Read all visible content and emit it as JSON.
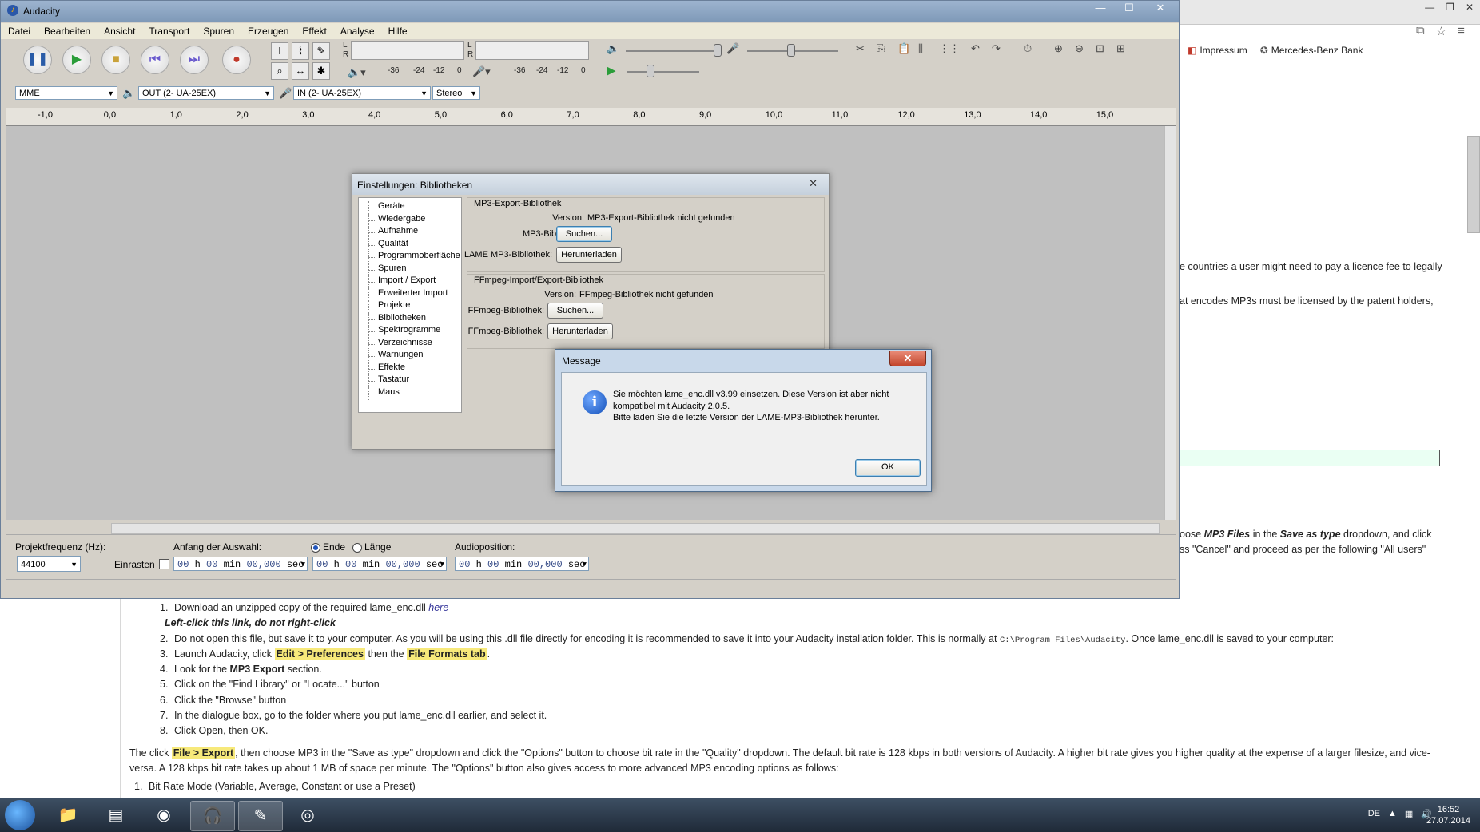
{
  "browser": {
    "bookmarks": [
      {
        "label": "Impressum",
        "icon": "impressum-icon"
      },
      {
        "label": "Mercedes-Benz Bank",
        "icon": "mercedes-icon"
      }
    ],
    "snippets": {
      "s1": "e countries a user might need to pay a licence fee to legally",
      "s2": "at encodes MP3s must be licensed by the patent holders,",
      "s3a": "oose ",
      "s3b": "MP3 Files",
      "s3c": " in the ",
      "s3d": "Save as type",
      "s3e": " dropdown, and click",
      "s4": "ss \"Cancel\" and proceed as per the following \"All users\""
    },
    "steps": [
      {
        "n": "1.",
        "text": "Download an unzipped copy of the required lame_enc.dll ",
        "link": "here"
      },
      {
        "n": "",
        "text": "Left-click this link, do not right-click"
      },
      {
        "n": "2.",
        "text": "Do not open this file, but save it to your computer. As you will be using this .dll file directly for encoding it is recommended to save it into your Audacity installation folder. This is normally at ",
        "mono": "C:\\Program Files\\Audacity",
        "after": ". Once lame_enc.dll is saved to your computer:"
      },
      {
        "n": "3.",
        "pre": "Launch Audacity, click ",
        "hl1": "Edit > Preferences",
        "mid": " then the ",
        "hl2": "File Formats tab",
        "post": "."
      },
      {
        "n": "4.",
        "pre": "Look for the ",
        "bold": "MP3 Export",
        "post": " section."
      },
      {
        "n": "5.",
        "text": "Click on the \"Find Library\" or \"Locate...\" button"
      },
      {
        "n": "6.",
        "text": "Click the \"Browse\" button"
      },
      {
        "n": "7.",
        "text": "In the dialogue box, go to the folder where you put lame_enc.dll earlier, and select it."
      },
      {
        "n": "8.",
        "text": "Click Open, then OK."
      }
    ],
    "para1_pre": "The click ",
    "para1_hl": "File > Export",
    "para1_post": ", then choose MP3 in the \"Save as type\" dropdown and click the \"Options\" button to choose bit rate in the \"Quality\" dropdown. The default bit rate is 128 kbps in both versions of Audacity. A higher bit rate gives you higher quality at the expense of a larger filesize, and vice-",
    "para2": "versa. A 128 kbps bit rate takes up about 1 MB of space per minute. The \"Options\" button also gives access to more advanced MP3 encoding options as follows:",
    "step_b1": "Bit Rate Mode (Variable, Average, Constant or use a Preset)"
  },
  "audacity": {
    "title": "Audacity",
    "menu": [
      "Datei",
      "Bearbeiten",
      "Ansicht",
      "Transport",
      "Spuren",
      "Erzeugen",
      "Effekt",
      "Analyse",
      "Hilfe"
    ],
    "meter_ticks": [
      "-36",
      "-24",
      "-12",
      "0"
    ],
    "meter_lr": [
      "L",
      "R"
    ],
    "devices": {
      "host": "MME",
      "output": "OUT (2- UA-25EX)",
      "input": "IN (2- UA-25EX)",
      "channels": "Stereo"
    },
    "ruler": [
      "-1,0",
      "0,0",
      "1,0",
      "2,0",
      "3,0",
      "4,0",
      "5,0",
      "6,0",
      "7,0",
      "8,0",
      "9,0",
      "10,0",
      "11,0",
      "12,0",
      "13,0",
      "14,0",
      "15,0"
    ],
    "selection": {
      "rate_label": "Projektfrequenz (Hz):",
      "rate": "44100",
      "snap_label": "Einrasten",
      "start_label": "Anfang der Auswahl:",
      "end_label": "Ende",
      "length_label": "Länge",
      "audio_pos_label": "Audioposition:",
      "time_hh": "00",
      "time_h": "h",
      "time_mm": "00",
      "time_min": "min",
      "time_ss": "00,000",
      "time_sec": "sec"
    }
  },
  "prefs": {
    "title": "Einstellungen: Bibliotheken",
    "tree": [
      "Geräte",
      "Wiedergabe",
      "Aufnahme",
      "Qualität",
      "Programmoberfläche",
      "Spuren",
      "Import / Export",
      "Erweiterter Import",
      "Projekte",
      "Bibliotheken",
      "Spektrogramme",
      "Verzeichnisse",
      "Warnungen",
      "Effekte",
      "Tastatur",
      "Maus"
    ],
    "mp3_group": "MP3-Export-Bibliothek",
    "version_label": "Version:",
    "mp3_version": "MP3-Export-Bibliothek nicht gefunden",
    "mp3_lib_label": "MP3-Bibliothek:",
    "lame_label": "LAME MP3-Bibliothek:",
    "ff_group": "FFmpeg-Import/Export-Bibliothek",
    "ff_version": "FFmpeg-Bibliothek nicht gefunden",
    "ff_lib_label": "FFmpeg-Bibliothek:",
    "search_btn": "Suchen...",
    "download_btn": "Herunterladen"
  },
  "message": {
    "title": "Message",
    "close": "✕",
    "line1": "Sie möchten lame_enc.dll v3.99 einsetzen. Diese Version ist aber nicht",
    "line2": "kompatibel mit Audacity 2.0.5.",
    "line3": "Bitte laden Sie die letzte Version der LAME-MP3-Bibliothek herunter.",
    "ok": "OK"
  },
  "taskbar": {
    "lang": "DE",
    "time": "16:52",
    "date": "27.07.2014"
  }
}
